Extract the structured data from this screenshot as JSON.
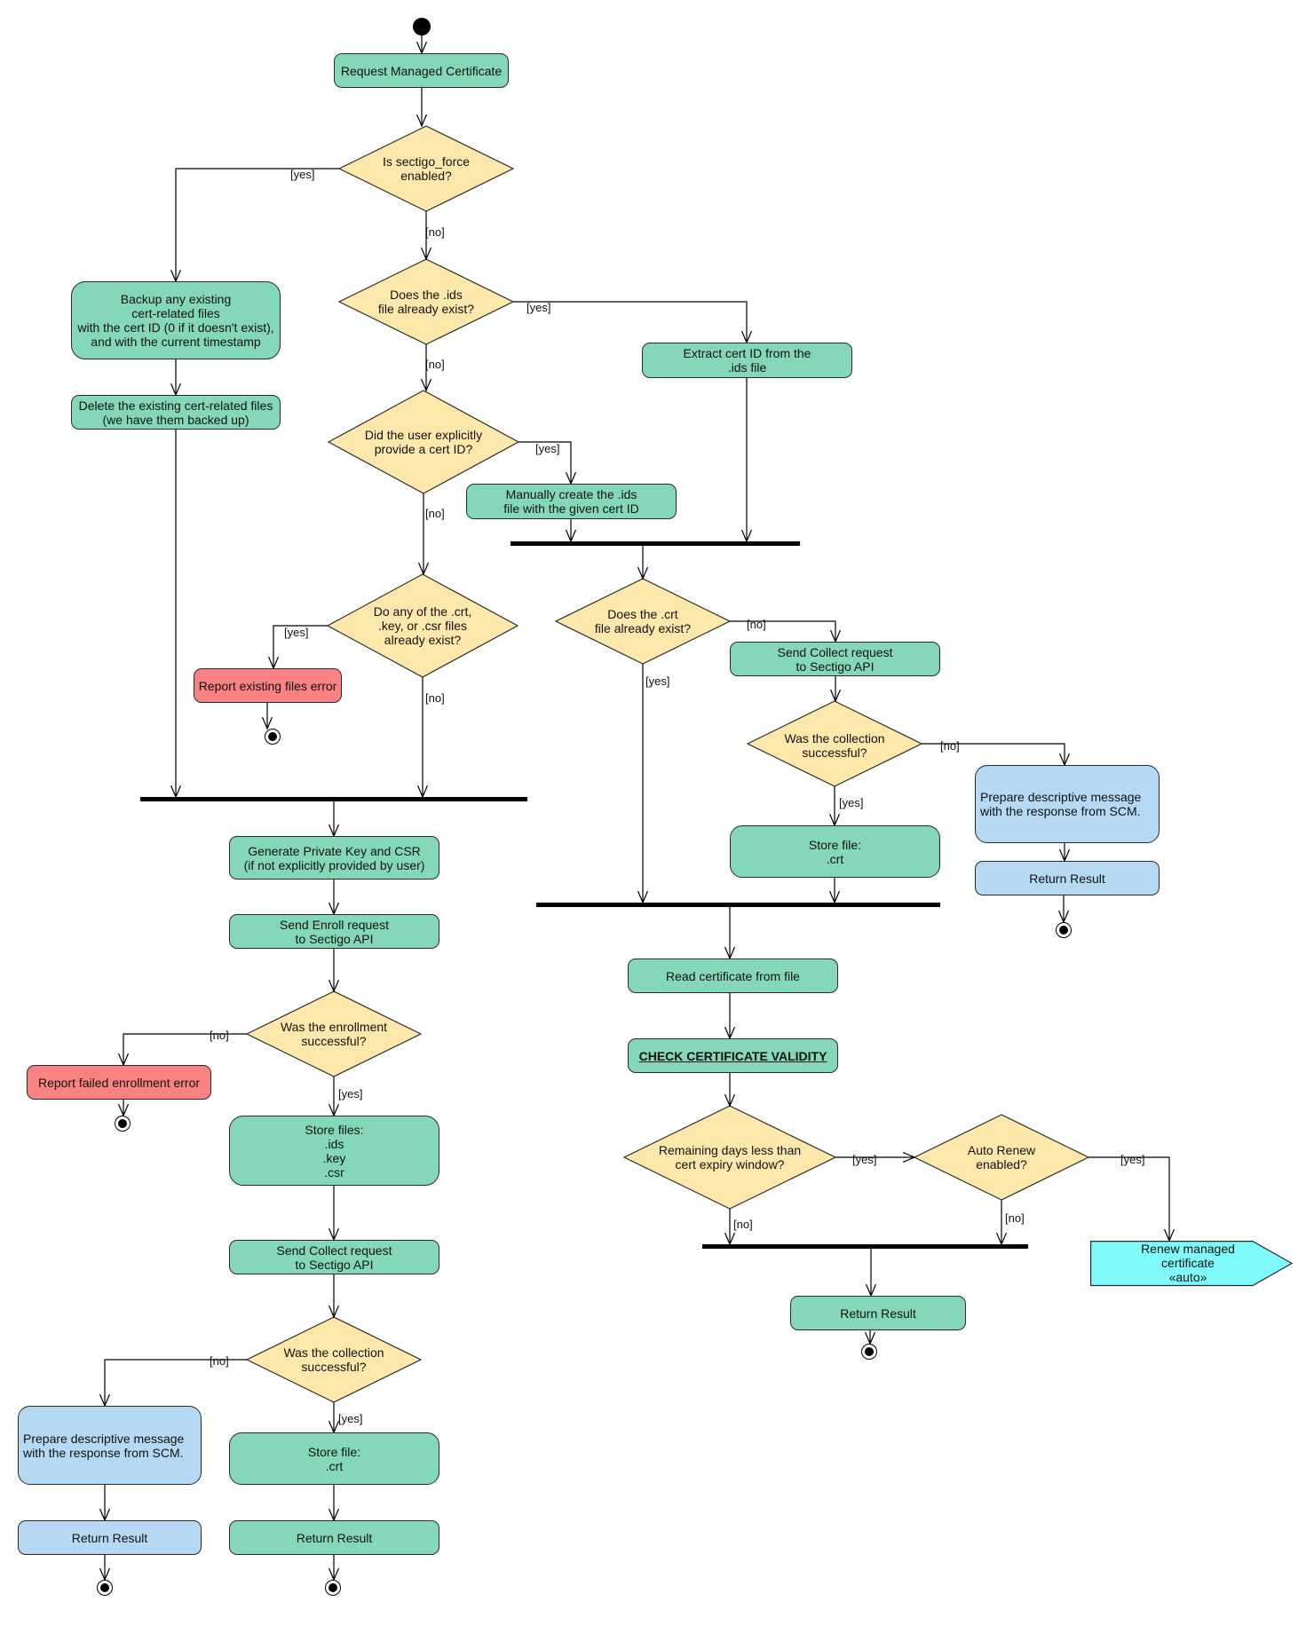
{
  "diagram": {
    "type": "UML activity diagram",
    "colors": {
      "action": "#84d8b9",
      "decision": "#fde8ab",
      "error": "#fa8282",
      "info": "#b5d9f3",
      "send_signal": "#7ffbfb"
    },
    "actions": {
      "request": "Request Managed Certificate",
      "backup": "Backup any existing\ncert-related files\nwith the cert ID (0 if it doesn't exist),\nand with the current timestamp",
      "delete": "Delete the existing cert-related files\n(we have them backed up)",
      "extract": "Extract cert ID from the\n.ids file",
      "manual_ids": "Manually create the .ids\nfile with the given cert ID",
      "report_existing": "Report existing files error",
      "send_collect_right": "Send Collect request\nto Sectigo API",
      "prepare_right": "Prepare descriptive message\nwith the response from SCM.",
      "return_right": "Return Result",
      "store_crt_right": "Store file:\n.crt",
      "generate": "Generate Private Key and CSR\n(if not explicitly provided by user)",
      "send_enroll": "Send Enroll request\nto Sectigo API",
      "report_enroll": "Report failed enrollment error",
      "store_files": "Store files:\n.ids\n.key\n.csr",
      "send_collect_left": "Send Collect request\nto Sectigo API",
      "prepare_left": "Prepare descriptive message\nwith the response from SCM.",
      "return_left_blue": "Return Result",
      "store_crt_left": "Store file:\n.crt",
      "return_left_green": "Return Result",
      "read_cert": "Read certificate from file",
      "check_validity": "CHECK CERTIFICATE VALIDITY",
      "return_bottom": "Return Result",
      "renew": "Renew managed certificate\n«auto»"
    },
    "decisions": {
      "force": "Is sectigo_force\nenabled?",
      "ids_exist": "Does the .ids\nfile already exist?",
      "user_cert": "Did the user explicitly\nprovide a cert ID?",
      "files_exist": "Do any of the .crt,\n.key, or .csr files\nalready exist?",
      "crt_exist": "Does the .crt\nfile already exist?",
      "collect_ok_right": "Was the collection\nsuccessful?",
      "enroll_ok": "Was the enrollment\nsuccessful?",
      "collect_ok_left": "Was the collection\nsuccessful?",
      "remaining": "Remaining days less than\ncert expiry window?",
      "auto_renew": "Auto Renew\nenabled?"
    },
    "guards": {
      "yes": "[yes]",
      "no": "[no]"
    }
  }
}
